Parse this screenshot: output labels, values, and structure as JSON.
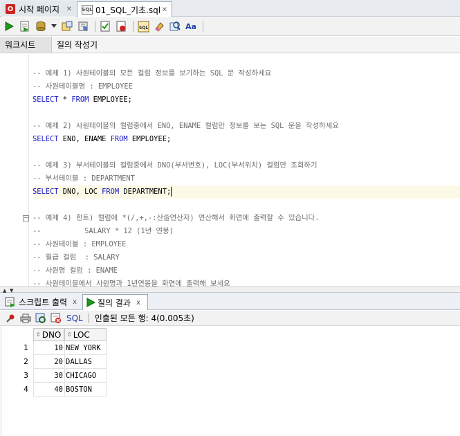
{
  "file_tabs": [
    {
      "label": "시작 페이지",
      "close": "✕"
    },
    {
      "label": "01_SQL_기초.sql",
      "close": "✕"
    }
  ],
  "sub_tabs": [
    {
      "label": "워크시트"
    },
    {
      "label": "질의 작성기"
    }
  ],
  "editor": {
    "lines": [
      {
        "parts": [
          {
            "t": "cm",
            "v": "-- 예제 1) 사원테이블의 모든 컬럼 정보를 보기하는 SQL 문 작성하세요"
          }
        ]
      },
      {
        "parts": [
          {
            "t": "cm",
            "v": "-- 사원테이블명 : EMPLOYEE"
          }
        ]
      },
      {
        "parts": [
          {
            "t": "kw",
            "v": "SELECT "
          },
          {
            "t": "ob",
            "v": "* "
          },
          {
            "t": "kw",
            "v": "FROM "
          },
          {
            "t": "ob",
            "v": "EMPLOYEE;"
          }
        ]
      },
      {
        "parts": []
      },
      {
        "parts": [
          {
            "t": "cm",
            "v": "-- 예제 2) 사원테이블의 컬럼중에서 ENO, ENAME 컬럼만 정보를 보는 SQL 문을 작성하세요"
          }
        ]
      },
      {
        "parts": [
          {
            "t": "kw",
            "v": "SELECT "
          },
          {
            "t": "ob",
            "v": "ENO, ENAME "
          },
          {
            "t": "kw",
            "v": "FROM "
          },
          {
            "t": "ob",
            "v": "EMPLOYEE;"
          }
        ]
      },
      {
        "parts": []
      },
      {
        "parts": [
          {
            "t": "cm",
            "v": "-- 예제 3) 부서테이블의 컬럼중에서 DNO(부서번호), LOC(부서위치) 컬럼만 조회하기"
          }
        ]
      },
      {
        "parts": [
          {
            "t": "cm",
            "v": "-- 부서테이블 : DEPARTMENT"
          }
        ]
      },
      {
        "parts": [
          {
            "t": "kw",
            "v": "SELECT "
          },
          {
            "t": "ob",
            "v": "DNO, LOC "
          },
          {
            "t": "kw",
            "v": "FROM "
          },
          {
            "t": "ob",
            "v": "DEPARTMENT;"
          }
        ],
        "current": true
      },
      {
        "parts": []
      },
      {
        "parts": [
          {
            "t": "cm",
            "v": "-- 예제 4) 힌트) 컬럼에 *(/,+,-:산술연산자) 연산해서 화면에 출력할 수 있습니다."
          }
        ]
      },
      {
        "parts": [
          {
            "t": "cm",
            "v": "--          SALARY * 12 (1년 연봉)"
          }
        ]
      },
      {
        "parts": [
          {
            "t": "cm",
            "v": "-- 사원테이블 : EMPLOYEE"
          }
        ]
      },
      {
        "parts": [
          {
            "t": "cm",
            "v": "-- 월급 컬럼  : SALARY"
          }
        ]
      },
      {
        "parts": [
          {
            "t": "cm",
            "v": "-- 사원명 컬럼 : ENAME"
          }
        ]
      },
      {
        "parts": [
          {
            "t": "cm",
            "v": "-- 사원테이블에서 사원명과 1년연봉을 화면에 출력해 보세요"
          }
        ]
      }
    ],
    "fold_symbol": "−"
  },
  "result_tabs": [
    {
      "label": "스크립트 출력",
      "close": "x"
    },
    {
      "label": "질의 결과",
      "close": "x"
    }
  ],
  "result_toolbar": {
    "sql_label": "SQL",
    "status": "인출된 모든 행: 4(0.005초)"
  },
  "grid": {
    "columns": [
      "DNO",
      "LOC"
    ],
    "rows": [
      {
        "num": "1",
        "dno": "10",
        "loc": "NEW YORK"
      },
      {
        "num": "2",
        "dno": "20",
        "loc": "DALLAS"
      },
      {
        "num": "3",
        "dno": "30",
        "loc": "CHICAGO"
      },
      {
        "num": "4",
        "dno": "40",
        "loc": "BOSTON"
      }
    ]
  },
  "icons": [
    "oracle-logo-icon",
    "sql-file-icon",
    "run-icon",
    "run-script-icon",
    "commit-icon",
    "rollback-icon",
    "format-icon",
    "eraser-icon",
    "explain-plan-icon",
    "autotrace-icon",
    "case-icon",
    "pin-icon",
    "print-icon",
    "refresh-icon",
    "export-icon"
  ],
  "colors": {
    "keyword": "#1515c8",
    "comment": "#6e6e6e",
    "current_line": "#fdf9e7",
    "run": "#1c9a1c",
    "oracle_red": "#d0201a"
  }
}
